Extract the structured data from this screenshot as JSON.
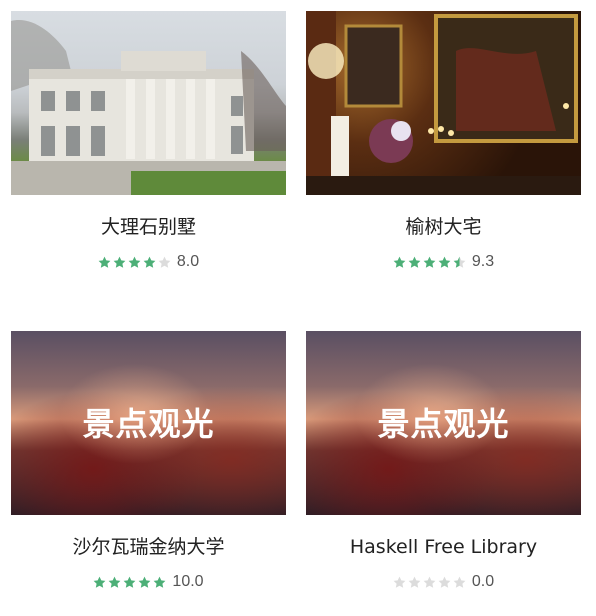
{
  "cards": [
    {
      "title": "大理石别墅",
      "score": "8.0",
      "stars": [
        "full",
        "full",
        "full",
        "full",
        "empty"
      ],
      "image_kind": "photo"
    },
    {
      "title": "榆树大宅",
      "score": "9.3",
      "stars": [
        "full",
        "full",
        "full",
        "full",
        "half"
      ],
      "image_kind": "photo"
    },
    {
      "title": "沙尔瓦瑞金纳大学",
      "score": "10.0",
      "stars": [
        "full",
        "full",
        "full",
        "full",
        "full"
      ],
      "image_kind": "placeholder",
      "image_text": "景点观光"
    },
    {
      "title": "Haskell Free Library",
      "score": "0.0",
      "stars": [
        "empty",
        "empty",
        "empty",
        "empty",
        "empty"
      ],
      "image_kind": "placeholder",
      "image_text": "景点观光"
    }
  ],
  "colors": {
    "star_full": "#4caf77",
    "star_empty": "#dcdcdc"
  }
}
